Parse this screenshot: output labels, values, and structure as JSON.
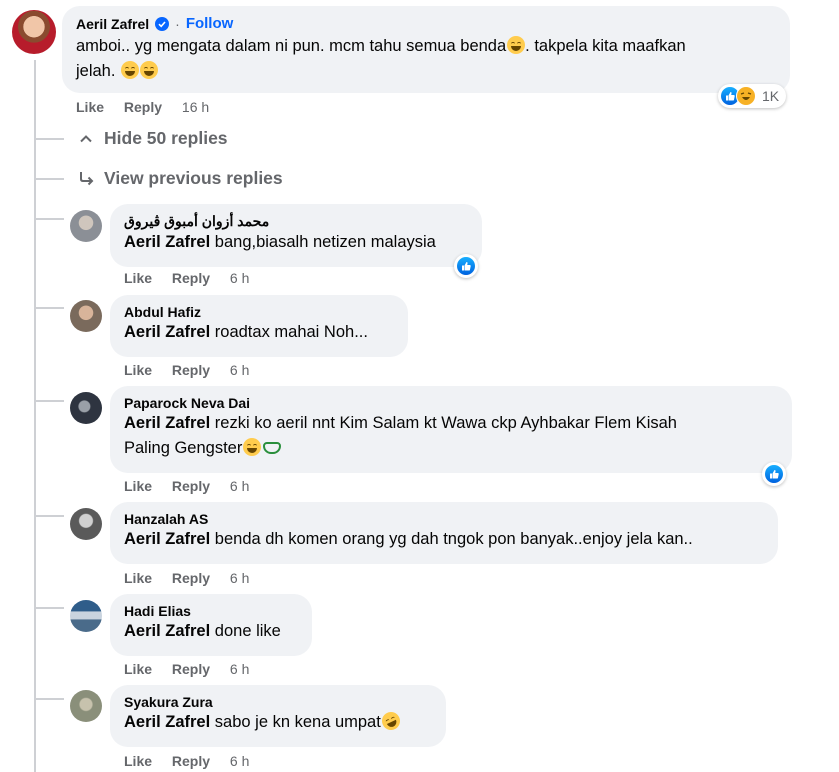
{
  "main_comment": {
    "author": "Aeril Zafrel",
    "follow_label": "Follow",
    "text_line1": "amboi.. yg mengata dalam ni pun. mcm tahu semua benda",
    "text_line1_tail": ". takpela kita maafkan",
    "text_line2": "jelah.",
    "like_label": "Like",
    "reply_label": "Reply",
    "time": "16 h",
    "reaction_count": "1K"
  },
  "hide_replies_label": "Hide 50 replies",
  "view_previous_label": "View previous replies",
  "replies": [
    {
      "author": "محمد أزوان أمبوق ڤيروق",
      "mention": "Aeril Zafrel",
      "text": " bang,biasalh netizen malaysia",
      "text2": "",
      "like": "Like",
      "reply": "Reply",
      "time": "6 h",
      "avatar_color": "#8b8f96"
    },
    {
      "author": "Abdul Hafiz",
      "mention": "Aeril Zafrel",
      "text": " roadtax mahai Noh...",
      "text2": "",
      "like": "Like",
      "reply": "Reply",
      "time": "6 h",
      "avatar_color": "#7a6a5c"
    },
    {
      "author": "Paparock Neva Dai",
      "mention": "Aeril Zafrel",
      "text": " rezki ko aeril nnt Kim Salam kt Wawa ckp Ayhbakar Flem Kisah",
      "text2": "Paling Gengster",
      "like": "Like",
      "reply": "Reply",
      "time": "6 h",
      "avatar_color": "#2e3440"
    },
    {
      "author": "Hanzalah AS",
      "mention": "Aeril Zafrel",
      "text": " benda dh komen orang yg dah tngok pon banyak..enjoy jela kan..",
      "text2": "",
      "like": "Like",
      "reply": "Reply",
      "time": "6 h",
      "avatar_color": "#5a5a5a"
    },
    {
      "author": "Hadi Elias",
      "mention": "Aeril Zafrel",
      "text": " done like",
      "text2": "",
      "like": "Like",
      "reply": "Reply",
      "time": "6 h",
      "avatar_color": "#4a6b8a"
    },
    {
      "author": "Syakura Zura",
      "mention": "Aeril Zafrel",
      "text": " sabo je kn kena umpat",
      "text2": "",
      "like": "Like",
      "reply": "Reply",
      "time": "6 h",
      "avatar_color": "#8a8f7a"
    }
  ],
  "colors": {
    "accent": "#0866ff",
    "meta": "#65676b",
    "bubble": "#f0f2f5"
  }
}
